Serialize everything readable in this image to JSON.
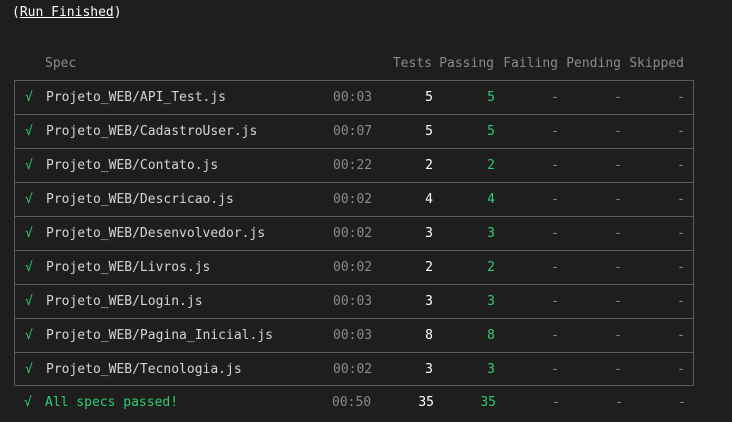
{
  "title": {
    "prefix": "(",
    "label": "Run Finished",
    "suffix": ")"
  },
  "header": {
    "spec": "Spec",
    "tests": "Tests",
    "passing": "Passing",
    "failing": "Failing",
    "pending": "Pending",
    "skipped": "Skipped"
  },
  "rows": [
    {
      "check": "√",
      "spec": "Projeto_WEB/API_Test.js",
      "duration": "00:03",
      "tests": "5",
      "passing": "5",
      "failing": "-",
      "pending": "-",
      "skipped": "-"
    },
    {
      "check": "√",
      "spec": "Projeto_WEB/CadastroUser.js",
      "duration": "00:07",
      "tests": "5",
      "passing": "5",
      "failing": "-",
      "pending": "-",
      "skipped": "-"
    },
    {
      "check": "√",
      "spec": "Projeto_WEB/Contato.js",
      "duration": "00:22",
      "tests": "2",
      "passing": "2",
      "failing": "-",
      "pending": "-",
      "skipped": "-"
    },
    {
      "check": "√",
      "spec": "Projeto_WEB/Descricao.js",
      "duration": "00:02",
      "tests": "4",
      "passing": "4",
      "failing": "-",
      "pending": "-",
      "skipped": "-"
    },
    {
      "check": "√",
      "spec": "Projeto_WEB/Desenvolvedor.js",
      "duration": "00:02",
      "tests": "3",
      "passing": "3",
      "failing": "-",
      "pending": "-",
      "skipped": "-"
    },
    {
      "check": "√",
      "spec": "Projeto_WEB/Livros.js",
      "duration": "00:02",
      "tests": "2",
      "passing": "2",
      "failing": "-",
      "pending": "-",
      "skipped": "-"
    },
    {
      "check": "√",
      "spec": "Projeto_WEB/Login.js",
      "duration": "00:03",
      "tests": "3",
      "passing": "3",
      "failing": "-",
      "pending": "-",
      "skipped": "-"
    },
    {
      "check": "√",
      "spec": "Projeto_WEB/Pagina_Inicial.js",
      "duration": "00:03",
      "tests": "8",
      "passing": "8",
      "failing": "-",
      "pending": "-",
      "skipped": "-"
    },
    {
      "check": "√",
      "spec": "Projeto_WEB/Tecnologia.js",
      "duration": "00:02",
      "tests": "3",
      "passing": "3",
      "failing": "-",
      "pending": "-",
      "skipped": "-"
    }
  ],
  "summary": {
    "check": "√",
    "spec": "All specs passed!",
    "duration": "00:50",
    "tests": "35",
    "passing": "35",
    "failing": "-",
    "pending": "-",
    "skipped": "-"
  },
  "colors": {
    "background": "#1e1e1e",
    "pass": "#2ecc71",
    "border": "#5a5a5a",
    "muted": "#8a8a8a"
  }
}
